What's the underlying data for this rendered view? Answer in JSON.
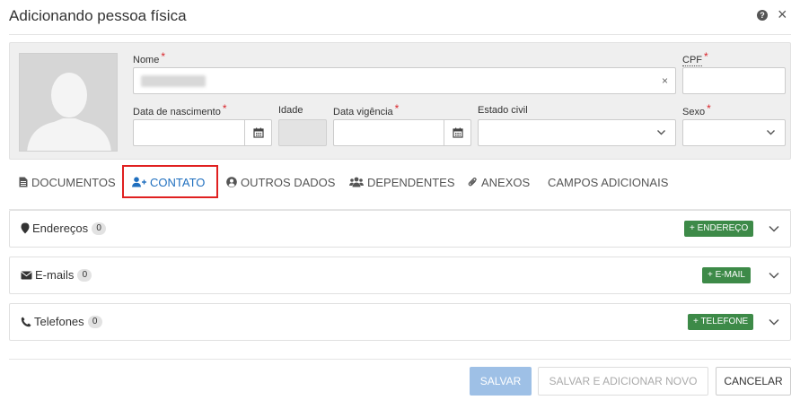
{
  "dialog": {
    "title": "Adicionando pessoa física"
  },
  "form": {
    "nome_label": "Nome",
    "cpf_label": "CPF",
    "data_nascimento_label": "Data de nascimento",
    "idade_label": "Idade",
    "data_vigencia_label": "Data vigência",
    "estado_civil_label": "Estado civil",
    "sexo_label": "Sexo",
    "required_mark": "*",
    "clear_symbol": "×"
  },
  "tabs": [
    {
      "label": "DOCUMENTOS",
      "icon": "document-icon"
    },
    {
      "label": "CONTATO",
      "icon": "user-plus-icon",
      "active": true
    },
    {
      "label": "OUTROS DADOS",
      "icon": "user-circle-icon"
    },
    {
      "label": "DEPENDENTES",
      "icon": "users-icon"
    },
    {
      "label": "ANEXOS",
      "icon": "paperclip-icon"
    },
    {
      "label": "CAMPOS ADICIONAIS"
    }
  ],
  "sections": [
    {
      "title": "Endereços",
      "count": "0",
      "button": "+ ENDEREÇO",
      "icon": "map-marker-icon"
    },
    {
      "title": "E-mails",
      "count": "0",
      "button": "+ E-MAIL",
      "icon": "envelope-icon"
    },
    {
      "title": "Telefones",
      "count": "0",
      "button": "+ TELEFONE",
      "icon": "phone-icon"
    }
  ],
  "footer": {
    "save": "SALVAR",
    "save_and_new": "SALVAR E ADICIONAR NOVO",
    "cancel": "CANCELAR"
  },
  "colors": {
    "active_tab": "#1f6fbf",
    "add_button": "#3d8a48",
    "required": "#d9252b",
    "highlight": "#e02020",
    "save_button": "#9ec0e6"
  }
}
